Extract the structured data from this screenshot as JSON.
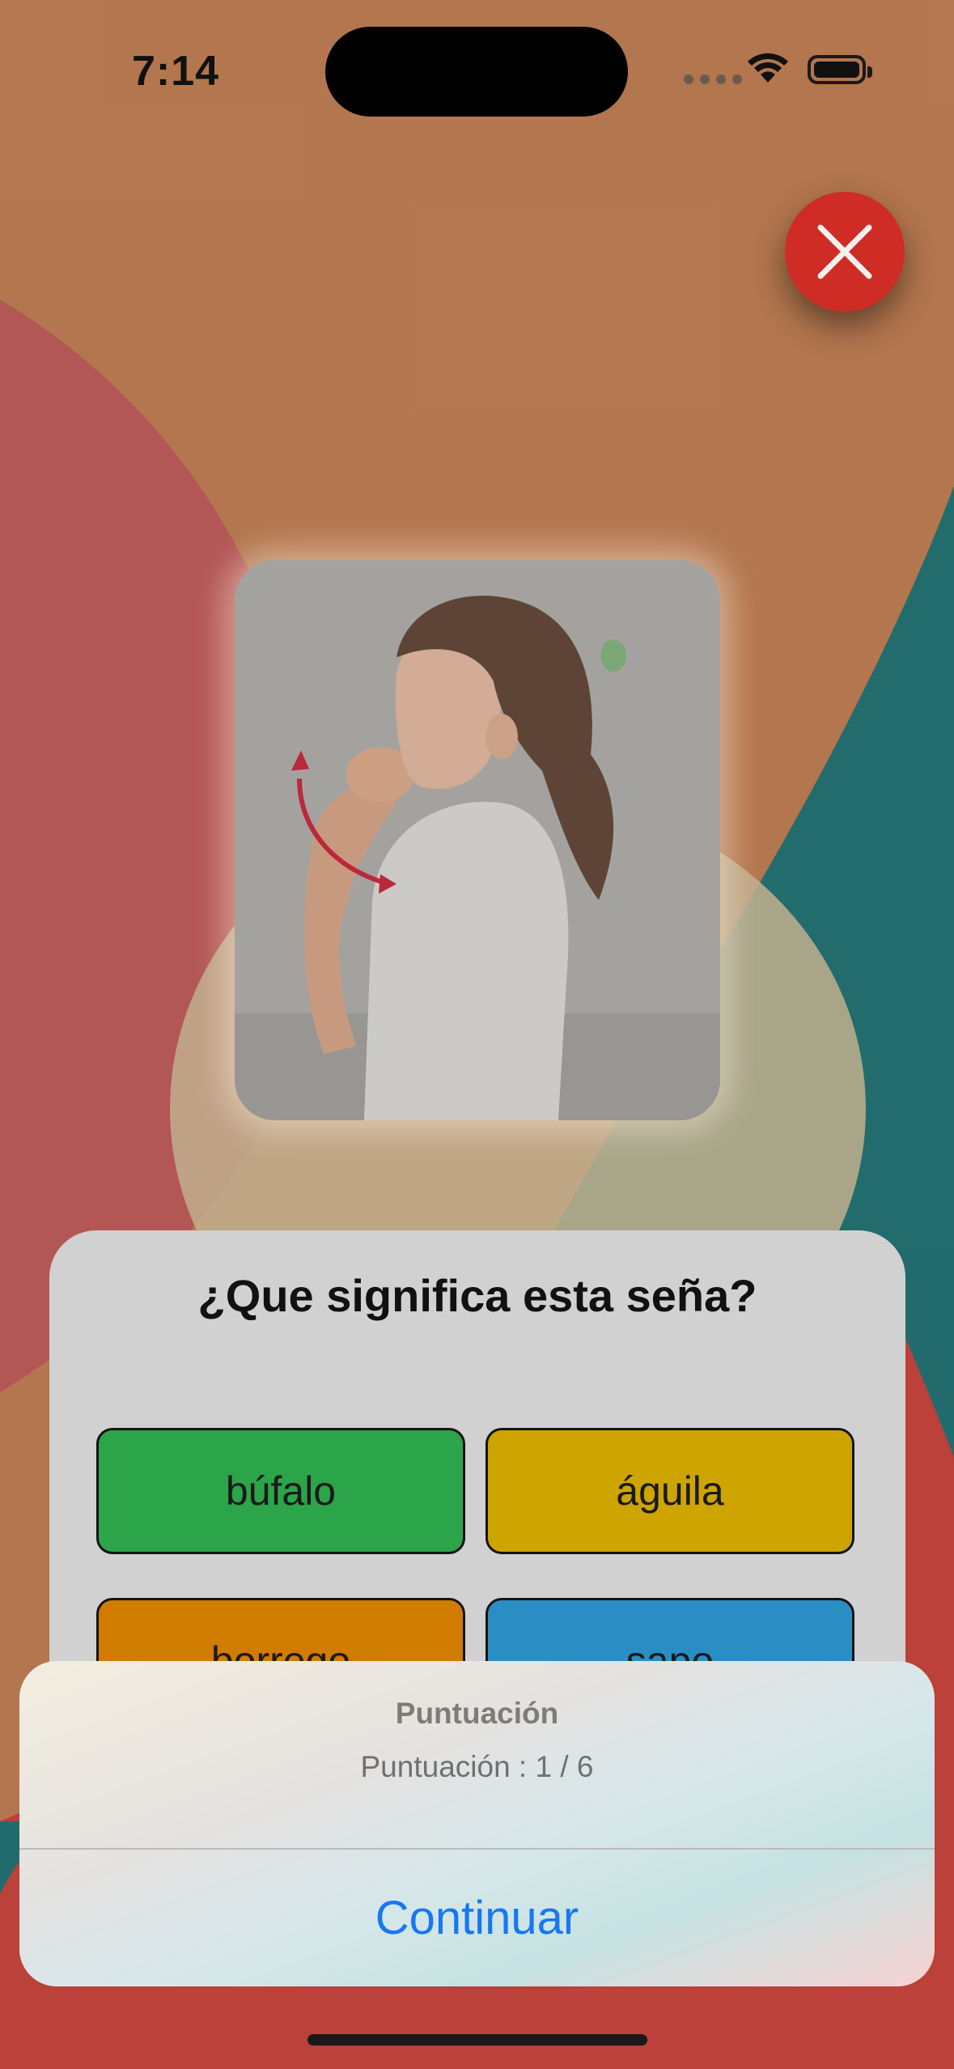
{
  "status_bar": {
    "time": "7:14"
  },
  "close_button": {
    "icon": "close-x-icon",
    "color": "#cf2c25"
  },
  "sign_image": {
    "subject": "child signing with hand at mouth, red curved arrow"
  },
  "quiz": {
    "question": "¿Que significa esta seña?",
    "options": [
      {
        "label": "búfalo",
        "color": "#2ca44a"
      },
      {
        "label": "águila",
        "color": "#cea400"
      },
      {
        "label": "borrego",
        "color": "#d07c00"
      },
      {
        "label": "sapo",
        "color": "#2a8ec4"
      }
    ]
  },
  "alert": {
    "title": "Puntuación",
    "message": "Puntuación : 1 / 6",
    "button": "Continuar"
  },
  "colors": {
    "background_orange": "#b87a50",
    "accent_red": "#cf2c25",
    "teal": "#1a6f74",
    "link_blue": "#1678f2"
  }
}
